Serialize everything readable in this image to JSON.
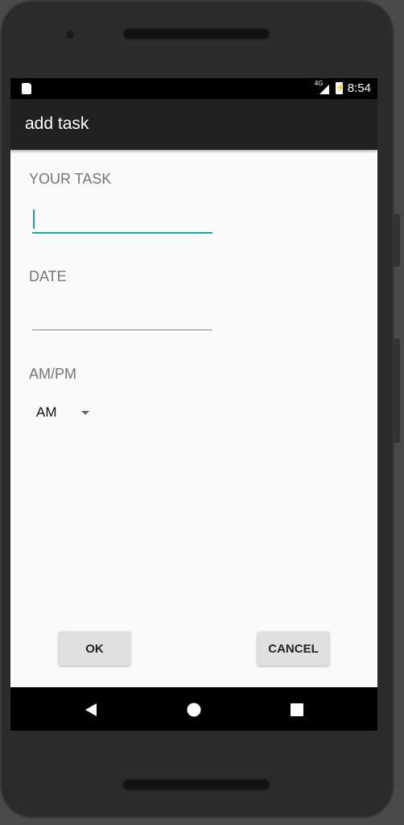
{
  "status_bar": {
    "network": "4G",
    "time": "8:54",
    "icons": [
      "sd-card-icon",
      "signal-icon",
      "battery-charging-icon"
    ]
  },
  "app_bar": {
    "title": "add task"
  },
  "form": {
    "task_label": "YOUR TASK",
    "task_value": "",
    "date_label": "DATE",
    "date_value": "",
    "ampm_label": "AM/PM",
    "ampm_selected": "AM"
  },
  "buttons": {
    "ok": "OK",
    "cancel": "CANCEL"
  },
  "nav_bar": {
    "icons": [
      "back-icon",
      "home-icon",
      "recents-icon"
    ]
  },
  "colors": {
    "accent": "#26a69a",
    "app_bar": "#212121",
    "background": "#fafafa"
  }
}
